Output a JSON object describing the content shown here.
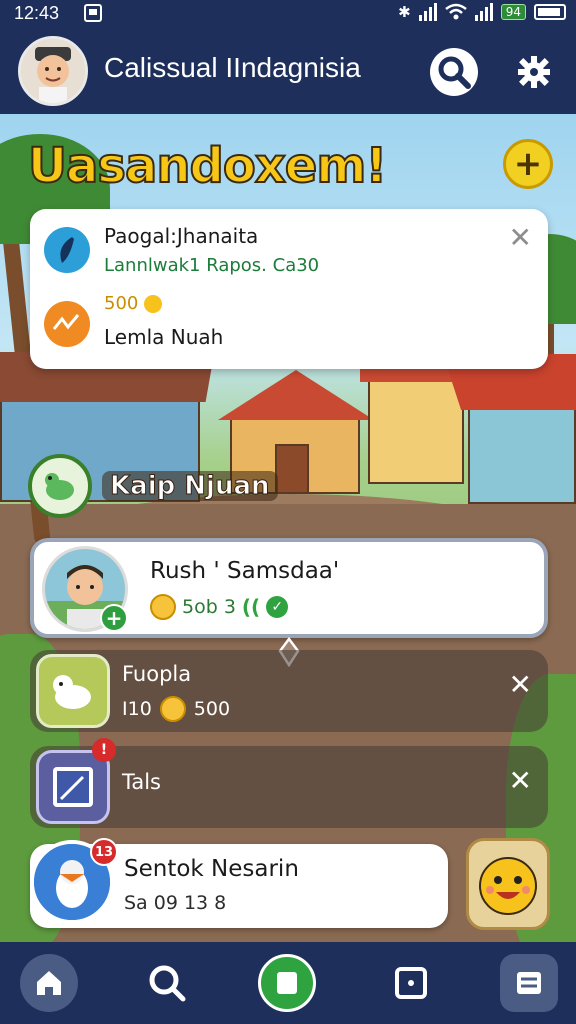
{
  "status_bar": {
    "time": "12:43",
    "battery_text": "94"
  },
  "app_bar": {
    "title": "Calissual IIndagnisia"
  },
  "scene": {
    "headline": "Uasandoxem!"
  },
  "notification": {
    "title": "Paogal:Jhanaita",
    "subtitle": "Lannlwak1 Rapos. Ca30",
    "coins": "500",
    "name": "Lemla Nuah"
  },
  "quest": {
    "label": "Kaip Njuan"
  },
  "friend": {
    "name": "Rush ' Samsdaa'",
    "meta": "5ob 3"
  },
  "rows": [
    {
      "title": "Fuopla",
      "meta_left": "I10",
      "meta_right": "500"
    },
    {
      "title": "Tals"
    }
  ],
  "bottom_card": {
    "name": "Sentok Nesarin",
    "sub": "Sa 09 13 8",
    "badge": "13"
  },
  "colors": {
    "accent": "#1e2f5c",
    "green": "#2fa33f",
    "gold": "#f7c718"
  }
}
